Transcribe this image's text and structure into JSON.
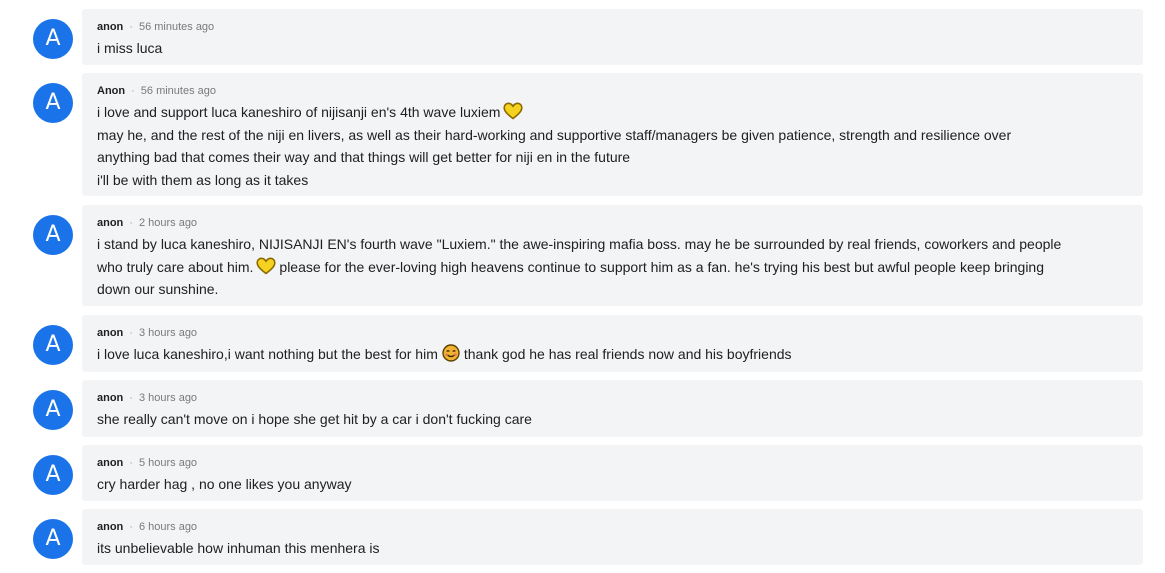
{
  "avatar_letter": "A",
  "colors": {
    "avatar": "#1a73e8",
    "card_background": "#f3f4f6",
    "heart": "#f5d21f",
    "heart_outline": "#8a6a00",
    "face": "#f2b233"
  },
  "icons": {
    "heart": "yellow-heart-icon",
    "face": "smiling-face-icon"
  },
  "comments": [
    {
      "author": "anon",
      "time": "56 minutes ago",
      "lines": [
        "i miss luca"
      ]
    },
    {
      "author": "Anon",
      "time": "56 minutes ago",
      "lines": [
        "i love and support luca kaneshiro of nijisanji en's 4th wave luxiem",
        "may he, and the rest of the niji en livers, as well as their hard-working and supportive staff/managers be given patience, strength and resilience over",
        "anything bad that comes their way and that things will get better for niji en in the future",
        "i'll be with them as long as it takes"
      ]
    },
    {
      "author": "anon",
      "time": "2 hours ago",
      "lines": [
        "i stand by luca kaneshiro, NIJISANJI EN's fourth wave \"Luxiem.\" the awe-inspiring mafia boss. may he be surrounded by real friends, coworkers and people",
        "who truly care about him.",
        "please for the ever-loving high heavens continue to support him as a fan. he's trying his best but awful people keep bringing",
        "down our sunshine."
      ]
    },
    {
      "author": "anon",
      "time": "3 hours ago",
      "lines": [
        "i love luca kaneshiro,i want nothing but the best for him",
        "thank god he has real friends now and his boyfriends"
      ]
    },
    {
      "author": "anon",
      "time": "3 hours ago",
      "lines": [
        "she really can't move on i hope she get hit by a car i don't fucking care"
      ]
    },
    {
      "author": "anon",
      "time": "5 hours ago",
      "lines": [
        "cry harder hag , no one likes you anyway"
      ]
    },
    {
      "author": "anon",
      "time": "6 hours ago",
      "lines": [
        "its unbelievable how inhuman this menhera is"
      ]
    }
  ]
}
